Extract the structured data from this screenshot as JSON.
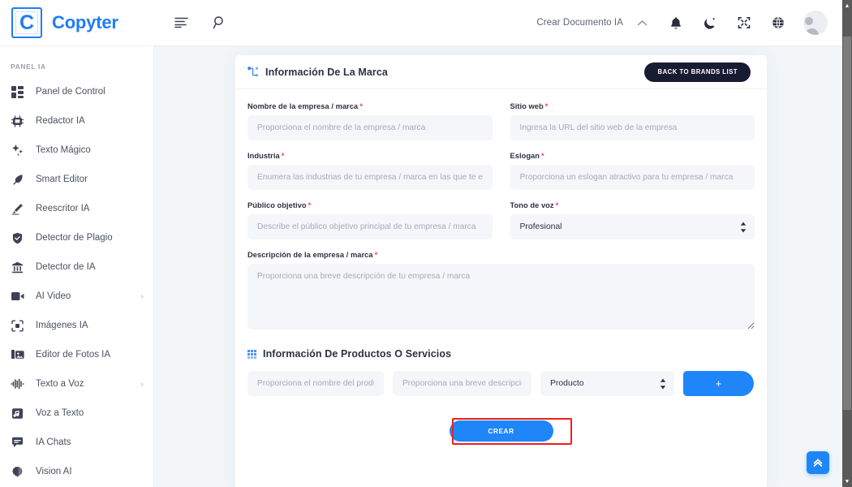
{
  "header": {
    "logo_letter": "C",
    "brand_name": "Copyter",
    "menu_icon": "list-lines-icon",
    "search_icon": "search-icon",
    "create_doc_label": "Crear Documento IA",
    "chevron_up_icon": "chevron-up-icon",
    "bell_icon": "bell-icon",
    "moon_icon": "moon-star-icon",
    "collapse_icon": "collapse-arrows-icon",
    "globe_icon": "globe-icon",
    "avatar_icon": "user-avatar"
  },
  "sidebar": {
    "section_title": "PANEL IA",
    "items": [
      {
        "label": "Panel de Control",
        "icon": "dashboard-grid-icon",
        "has_arrow": false
      },
      {
        "label": "Redactor IA",
        "icon": "robot-chip-icon",
        "has_arrow": false
      },
      {
        "label": "Texto Mágico",
        "icon": "sparkles-icon",
        "has_arrow": false
      },
      {
        "label": "Smart Editor",
        "icon": "feather-pen-icon",
        "has_arrow": false
      },
      {
        "label": "Reescritor IA",
        "icon": "pencil-icon",
        "has_arrow": false
      },
      {
        "label": "Detector de Plagio",
        "icon": "shield-check-icon",
        "has_arrow": false
      },
      {
        "label": "Detector de IA",
        "icon": "bank-scan-icon",
        "has_arrow": false
      },
      {
        "label": "AI Video",
        "icon": "video-camera-icon",
        "has_arrow": true
      },
      {
        "label": "Imágenes IA",
        "icon": "image-frame-icon",
        "has_arrow": false
      },
      {
        "label": "Editor de Fotos IA",
        "icon": "photo-stack-icon",
        "has_arrow": false
      },
      {
        "label": "Texto a Voz",
        "icon": "audio-waveform-icon",
        "has_arrow": true
      },
      {
        "label": "Voz a Texto",
        "icon": "music-note-box-icon",
        "has_arrow": false
      },
      {
        "label": "IA Chats",
        "icon": "chat-bubble-icon",
        "has_arrow": false
      },
      {
        "label": "Vision AI",
        "icon": "brain-icon",
        "has_arrow": false
      }
    ]
  },
  "brand_card": {
    "title": "Información De La Marca",
    "title_icon": "sitemap-branch-icon",
    "back_button_label": "BACK TO BRANDS LIST",
    "fields": {
      "company_name": {
        "label": "Nombre de la empresa / marca",
        "required": "*",
        "placeholder": "Proporciona el nombre de la empresa / marca",
        "value": ""
      },
      "website": {
        "label": "Sitio web",
        "required": "*",
        "placeholder": "Ingresa la URL del sitio web de la empresa",
        "value": ""
      },
      "industry": {
        "label": "Industria",
        "required": "*",
        "placeholder": "Enumera las industrias de tu empresa / marca en las que te enfoca",
        "value": ""
      },
      "slogan": {
        "label": "Eslogan",
        "required": "*",
        "placeholder": "Proporciona un eslogan atractivo para tu empresa / marca",
        "value": ""
      },
      "audience": {
        "label": "Público objetivo",
        "required": "*",
        "placeholder": "Describe el público objetivo principal de tu empresa / marca",
        "value": ""
      },
      "tone": {
        "label": "Tono de voz",
        "required": "*",
        "selected": "Profesional",
        "options": [
          "Profesional"
        ]
      },
      "description": {
        "label": "Descripción de la empresa / marca",
        "required": "*",
        "placeholder": "Proporciona una breve descripción de tu empresa / marca",
        "value": ""
      }
    }
  },
  "products_card": {
    "title": "Información De Productos O Servicios",
    "title_icon": "dots-grid-icon",
    "row": {
      "name_placeholder": "Proporciona el nombre del producto",
      "desc_placeholder": "Proporciona una breve descripción",
      "type_selected": "Producto",
      "type_options": [
        "Producto"
      ],
      "add_label": "+"
    }
  },
  "submit": {
    "label": "CREAR",
    "highlight_color": "#f01e1e"
  },
  "to_top": {
    "icon": "double-chevron-up-icon"
  },
  "colors": {
    "brand_blue": "#1f7df5",
    "button_blue": "#1f86f9",
    "dark_button": "#181c32",
    "required_red": "#f1416c",
    "page_bg": "#f2f6f9",
    "input_bg": "#f4f6f9"
  },
  "scrollbar": {
    "up_arrow": "▲",
    "down_arrow": "▼"
  }
}
